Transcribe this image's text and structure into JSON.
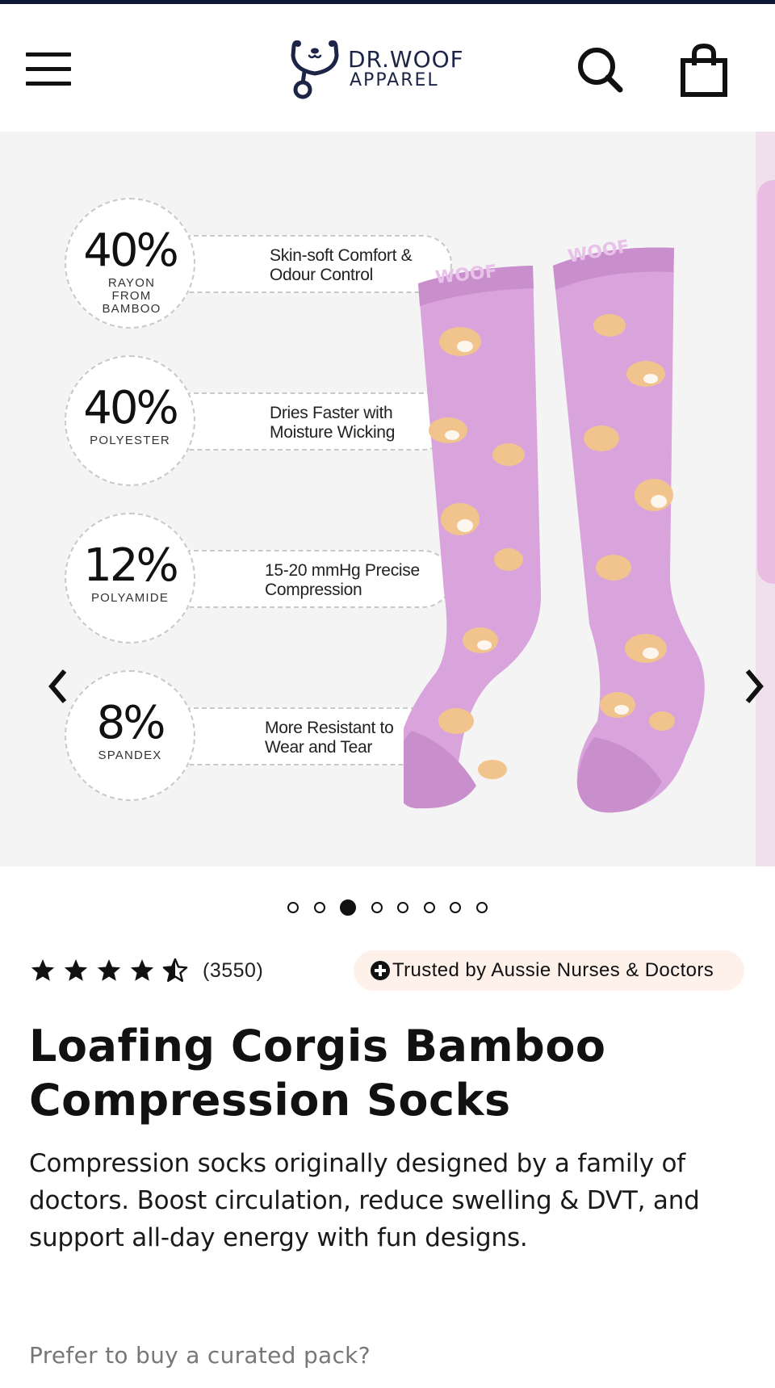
{
  "header": {
    "logo_line1": "DR.WOOF",
    "logo_line2": "APPAREL",
    "icons": [
      "menu-icon",
      "search-icon",
      "shopping-bag-icon"
    ]
  },
  "gallery": {
    "specs": [
      {
        "percent": "40%",
        "material": "RAYON FROM BAMBOO",
        "description": "Skin-soft Comfort & Odour Control"
      },
      {
        "percent": "40%",
        "material": "POLYESTER",
        "description": "Dries Faster with Moisture Wicking"
      },
      {
        "percent": "12%",
        "material": "POLYAMIDE",
        "description": "15-20 mmHg Precise Compression"
      },
      {
        "percent": "8%",
        "material": "SPANDEX",
        "description": "More Resistant to Wear and Tear"
      }
    ],
    "sock_text": "WOOF",
    "slide_count": 8,
    "active_slide": 3,
    "colors": {
      "sock": "#d9a3dc",
      "sock_dark": "#c98fcd",
      "corgi": "#f2c48d"
    }
  },
  "product": {
    "rating_stars": 4.5,
    "review_count": "(3550)",
    "trust_badge": "Trusted by Aussie Nurses & Doctors",
    "title_line1": "Loafing Corgis Bamboo",
    "title_line2": "Compression Socks",
    "description": "Compression socks originally designed by a family of doctors. Boost circulation, reduce swelling & DVT, and support all-day energy with fun designs.",
    "pack_prompt": "Prefer to buy a curated pack?"
  },
  "colors": {
    "brand_navy": "#1c2547",
    "top_bar": "#0f1738",
    "badge_bg": "#fdf1ea"
  }
}
